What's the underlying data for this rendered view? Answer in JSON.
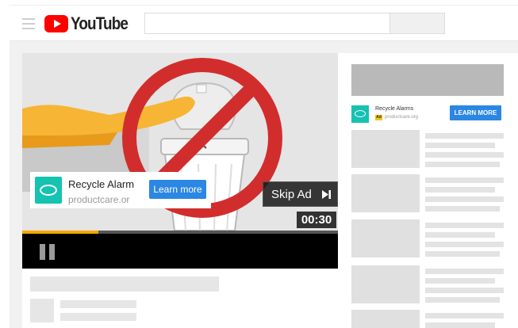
{
  "header": {
    "logo_text": "YouTube",
    "icons": {
      "menu": "hamburger-menu-icon",
      "logo": "youtube-play-logo-icon"
    }
  },
  "search": {
    "value": "",
    "placeholder": ""
  },
  "player": {
    "progress": 0.24,
    "ad": {
      "title": "Recycle Alarm",
      "url": "productcare.or",
      "learn_more_label": "Learn more"
    },
    "skip_label": "Skip Ad",
    "timer": "00:30",
    "icons": {
      "pause": "pause-icon",
      "skip": "skip-forward-icon",
      "no_sign": "prohibition-sign-icon"
    }
  },
  "sidebar": {
    "ad": {
      "title": "Recycle Alarms",
      "badge": "Ad",
      "url": "productcare.org",
      "learn_more_label": "LEARN MORE"
    }
  },
  "colors": {
    "accent_blue": "#2b87e3",
    "youtube_red": "#ff0000",
    "progress_yellow": "#f5a800",
    "ad_teal": "#16c2b0"
  }
}
